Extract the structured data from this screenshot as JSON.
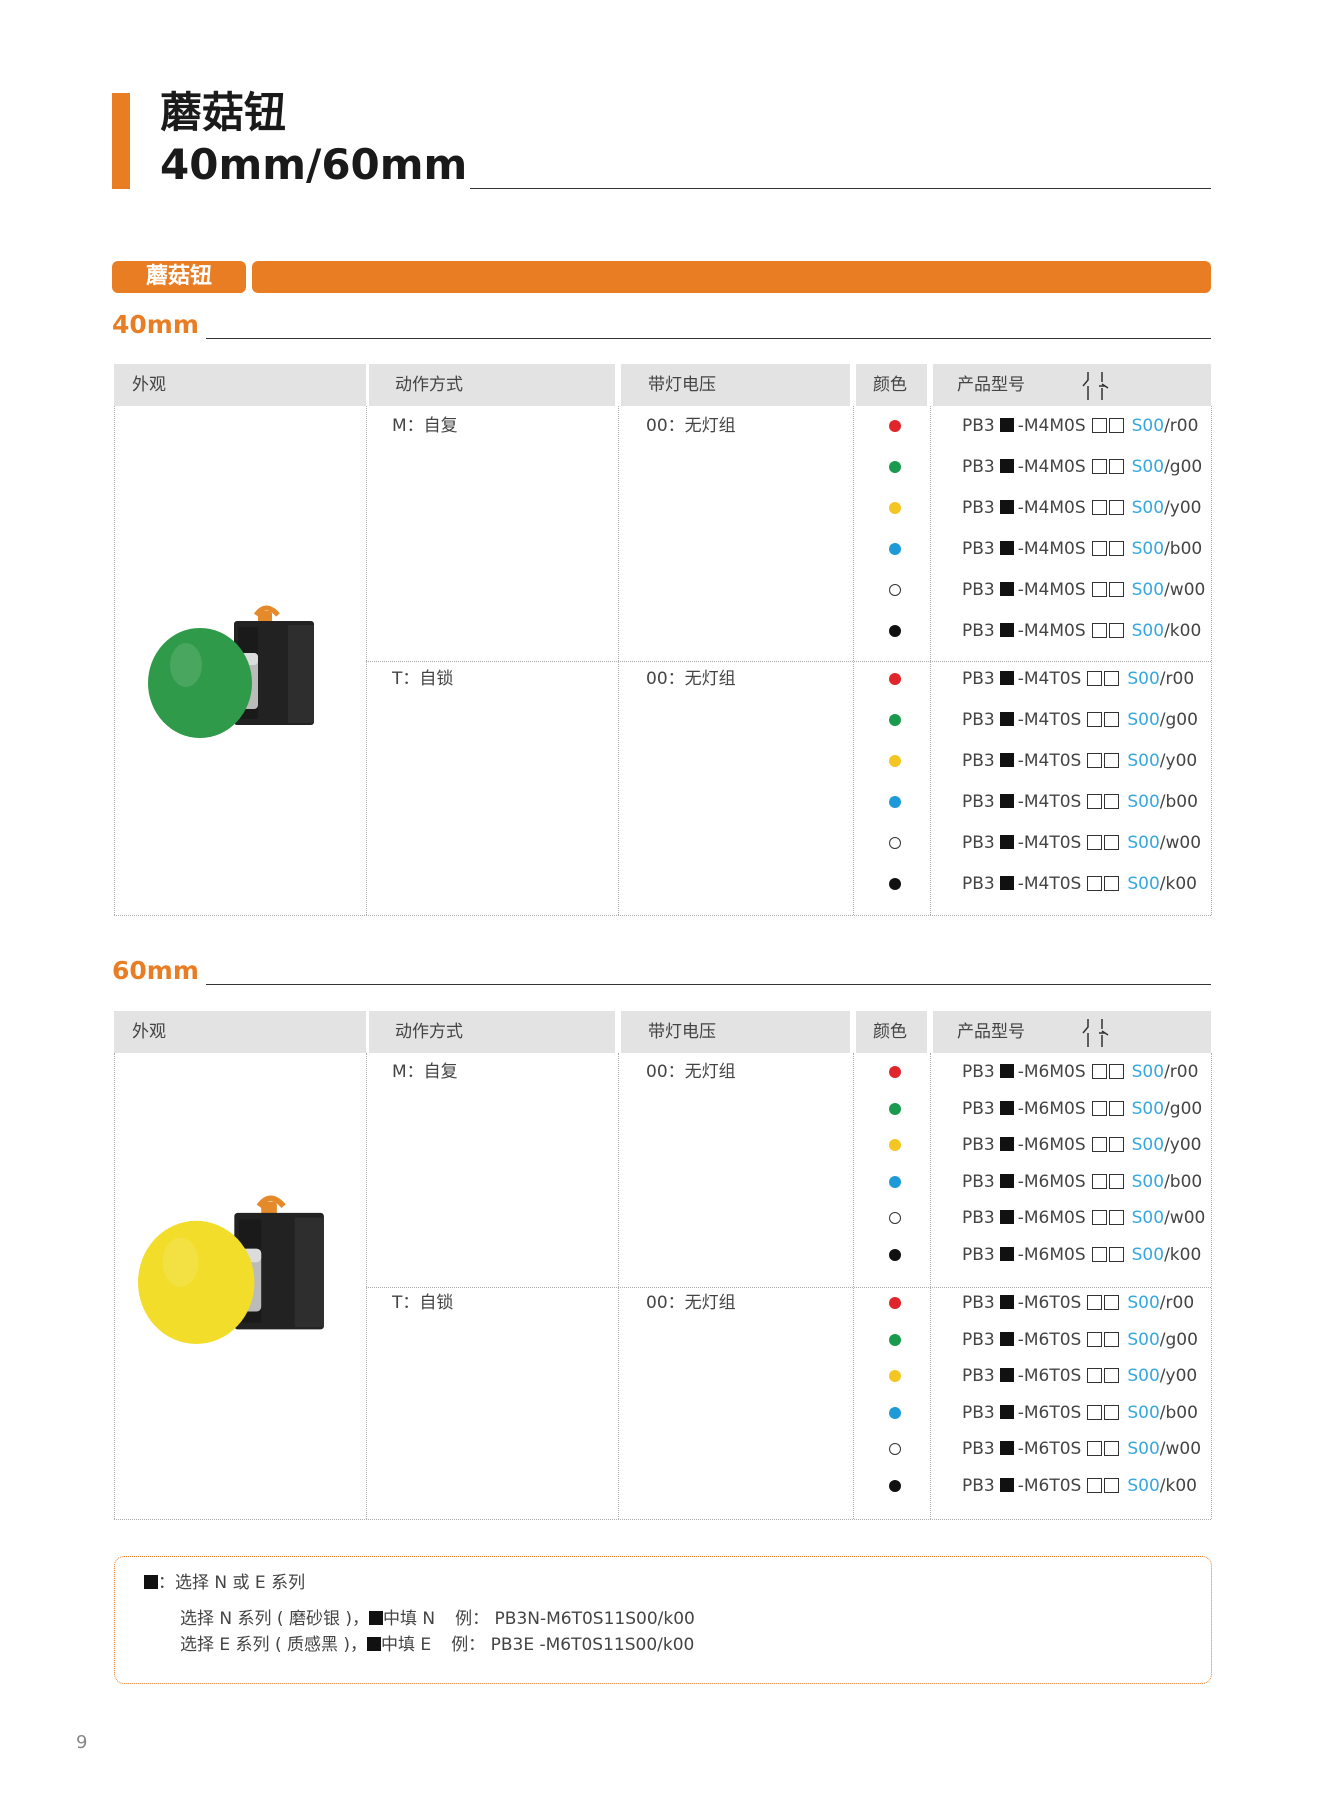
{
  "title": {
    "line1": "蘑菇钮",
    "line2": "40mm/60mm"
  },
  "section_label": "蘑菇钮",
  "table_headers": {
    "appearance": "外观",
    "action": "动作方式",
    "voltage": "带灯电压",
    "color": "颜色",
    "model": "产品型号"
  },
  "colors": {
    "accent": "#e97d24",
    "red": "#e0262b",
    "green": "#1a9a4c",
    "yellow": "#f3c623",
    "blue": "#1f9ad8",
    "white": "#ffffff",
    "black": "#111111",
    "suffix_blue": "#36a8df"
  },
  "variants": [
    {
      "size_label": "40mm",
      "image": {
        "description_icon": "green-mushroom-button-image",
        "cap_color": "#2f9a49"
      },
      "groups": [
        {
          "action": "M：自复",
          "voltage": "00：无灯组",
          "rows": [
            {
              "color": "red",
              "prefix": "PB3",
              "code": "-M4M0S",
              "suffix": "S00",
              "tail": "/r00"
            },
            {
              "color": "green",
              "prefix": "PB3",
              "code": "-M4M0S",
              "suffix": "S00",
              "tail": "/g00"
            },
            {
              "color": "yellow",
              "prefix": "PB3",
              "code": "-M4M0S",
              "suffix": "S00",
              "tail": "/y00"
            },
            {
              "color": "blue",
              "prefix": "PB3",
              "code": "-M4M0S",
              "suffix": "S00",
              "tail": "/b00"
            },
            {
              "color": "white",
              "prefix": "PB3",
              "code": "-M4M0S",
              "suffix": "S00",
              "tail": "/w00"
            },
            {
              "color": "black",
              "prefix": "PB3",
              "code": "-M4M0S",
              "suffix": "S00",
              "tail": "/k00"
            }
          ]
        },
        {
          "action": "T：自锁",
          "voltage": "00：无灯组",
          "rows": [
            {
              "color": "red",
              "prefix": "PB3",
              "code": "-M4T0S",
              "suffix": "S00",
              "tail": "/r00"
            },
            {
              "color": "green",
              "prefix": "PB3",
              "code": "-M4T0S",
              "suffix": "S00",
              "tail": "/g00"
            },
            {
              "color": "yellow",
              "prefix": "PB3",
              "code": "-M4T0S",
              "suffix": "S00",
              "tail": "/y00"
            },
            {
              "color": "blue",
              "prefix": "PB3",
              "code": "-M4T0S",
              "suffix": "S00",
              "tail": "/b00"
            },
            {
              "color": "white",
              "prefix": "PB3",
              "code": "-M4T0S",
              "suffix": "S00",
              "tail": "/w00"
            },
            {
              "color": "black",
              "prefix": "PB3",
              "code": "-M4T0S",
              "suffix": "S00",
              "tail": "/k00"
            }
          ]
        }
      ]
    },
    {
      "size_label": "60mm",
      "image": {
        "description_icon": "yellow-mushroom-button-image",
        "cap_color": "#f2dd2a"
      },
      "groups": [
        {
          "action": "M：自复",
          "voltage": "00：无灯组",
          "rows": [
            {
              "color": "red",
              "prefix": "PB3",
              "code": "-M6M0S",
              "suffix": "S00",
              "tail": "/r00"
            },
            {
              "color": "green",
              "prefix": "PB3",
              "code": "-M6M0S",
              "suffix": "S00",
              "tail": "/g00"
            },
            {
              "color": "yellow",
              "prefix": "PB3",
              "code": "-M6M0S",
              "suffix": "S00",
              "tail": "/y00"
            },
            {
              "color": "blue",
              "prefix": "PB3",
              "code": "-M6M0S",
              "suffix": "S00",
              "tail": "/b00"
            },
            {
              "color": "white",
              "prefix": "PB3",
              "code": "-M6M0S",
              "suffix": "S00",
              "tail": "/w00"
            },
            {
              "color": "black",
              "prefix": "PB3",
              "code": "-M6M0S",
              "suffix": "S00",
              "tail": "/k00"
            }
          ]
        },
        {
          "action": "T：自锁",
          "voltage": "00：无灯组",
          "rows": [
            {
              "color": "red",
              "prefix": "PB3",
              "code": "-M6T0S",
              "suffix": "S00",
              "tail": "/r00"
            },
            {
              "color": "green",
              "prefix": "PB3",
              "code": "-M6T0S",
              "suffix": "S00",
              "tail": "/g00"
            },
            {
              "color": "yellow",
              "prefix": "PB3",
              "code": "-M6T0S",
              "suffix": "S00",
              "tail": "/y00"
            },
            {
              "color": "blue",
              "prefix": "PB3",
              "code": "-M6T0S",
              "suffix": "S00",
              "tail": "/b00"
            },
            {
              "color": "white",
              "prefix": "PB3",
              "code": "-M6T0S",
              "suffix": "S00",
              "tail": "/w00"
            },
            {
              "color": "black",
              "prefix": "PB3",
              "code": "-M6T0S",
              "suffix": "S00",
              "tail": "/k00"
            }
          ]
        }
      ]
    }
  ],
  "notes": {
    "line1": "：选择 N 或 E 系列",
    "line2_a": "选择 N 系列 ( 磨砂银 )，",
    "line2_b": "中填 N",
    "line2_c": "例： PB3N-M6T0S11S00/k00",
    "line3_a": "选择 E 系列 ( 质感黑 )，",
    "line3_b": "中填 E",
    "line3_c": "例： PB3E -M6T0S11S00/k00"
  },
  "page_number": "9"
}
